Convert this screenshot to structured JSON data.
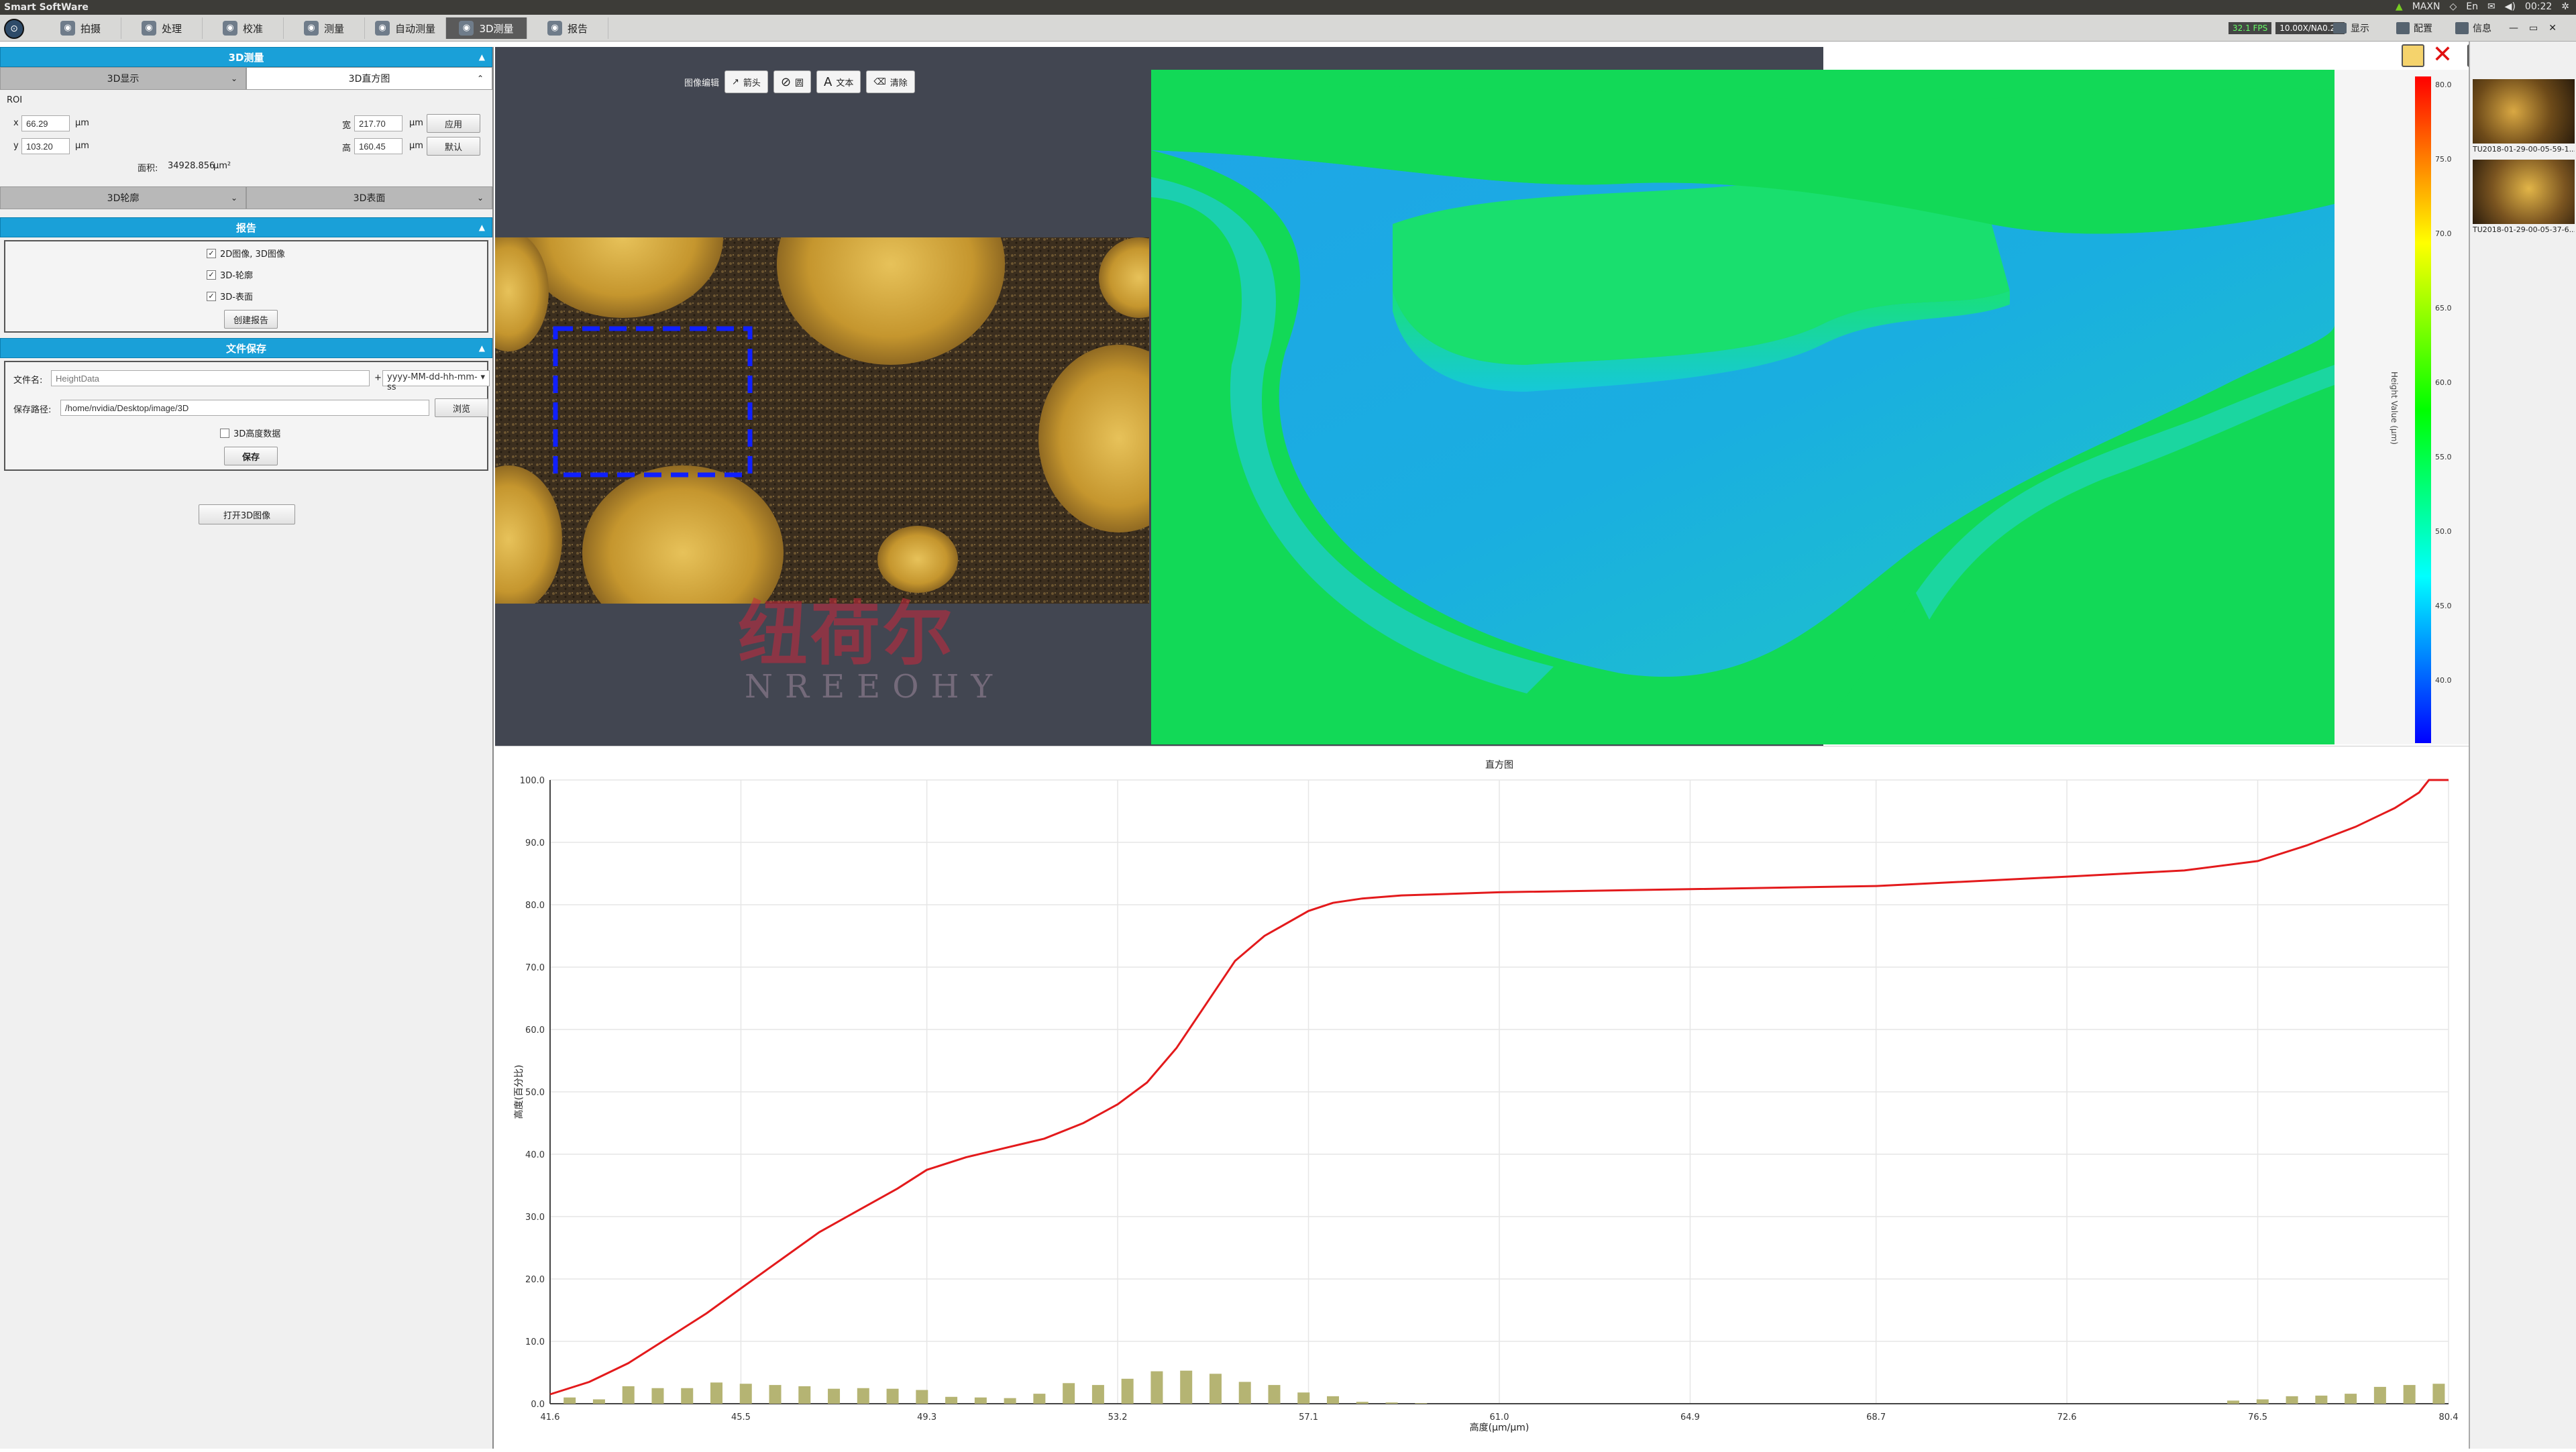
{
  "system_bar": {
    "title": "Smart SoftWare",
    "tray": [
      "MAXN",
      "00:22"
    ]
  },
  "toolbar": {
    "tabs": [
      {
        "label": "拍摄",
        "icon": "camera-icon"
      },
      {
        "label": "处理",
        "icon": "process-icon"
      },
      {
        "label": "校准",
        "icon": "calibrate-icon"
      },
      {
        "label": "测量",
        "icon": "measure-icon"
      },
      {
        "label": "自动测量",
        "icon": "auto-measure-icon"
      },
      {
        "label": "3D测量",
        "icon": "3d-measure-icon",
        "active": true
      },
      {
        "label": "报告",
        "icon": "report-icon"
      }
    ],
    "status_fps": "32.1 FPS",
    "status_exposure": "10.00X/NA0.25",
    "display_label": "显示",
    "config_label": "配置",
    "info_label": "信息"
  },
  "left_panel": {
    "section_3d": "3D测量",
    "subtabs_top": [
      "3D显示",
      "3D直方图"
    ],
    "roi_label": "ROI",
    "x_label": "x",
    "x_value": "66.29",
    "y_label": "y",
    "y_value": "103.20",
    "unit": "μm",
    "width_label": "宽",
    "width_value": "217.70",
    "height_label": "高",
    "height_value": "160.45",
    "apply_button": "应用",
    "default_button": "默认",
    "area_label": "面积:",
    "area_value": "34928.856",
    "area_unit": "μm²",
    "subtabs_bottom": [
      "3D轮廓",
      "3D表面"
    ],
    "section_report": "报告",
    "report_options": [
      "2D图像, 3D图像",
      "3D-轮廓",
      "3D-表面"
    ],
    "create_report_button": "创建报告",
    "section_save": "文件保存",
    "filename_label": "文件名:",
    "filename_placeholder": "HeightData",
    "plus": "+",
    "date_format": "yyyy-MM-dd-hh-mm-ss",
    "path_label": "保存路径:",
    "path_value": "/home/nvidia/Desktop/image/3D",
    "browse_button": "浏览",
    "save_height_label": "3D高度数据",
    "save_button": "保存",
    "open_3d_button": "打开3D图像"
  },
  "edit_bar": {
    "label": "图像编辑",
    "arrow": "箭头",
    "circle": "圆",
    "text": "文本",
    "clear": "清除"
  },
  "watermark": {
    "cn": "纽荷尔",
    "en": "NREEOHY"
  },
  "colorbar": {
    "ticks": [
      "80.0",
      "75.0",
      "70.0",
      "65.0",
      "60.0",
      "55.0",
      "50.0",
      "45.0",
      "40.0"
    ],
    "label": "Height Value (μm)",
    "colors": [
      "#ff0000",
      "#ffff00",
      "#00ff00",
      "#00ffff",
      "#0000ff"
    ]
  },
  "thumbnails": [
    {
      "name": "TU2018-01-29-00-05-59-1..."
    },
    {
      "name": "TU2018-01-29-00-05-37-6..."
    }
  ],
  "chart_data": {
    "type": "line",
    "title": "直方图",
    "xlabel": "高度(μm/μm)",
    "ylabel": "高度(百分比)",
    "xlim": [
      41.6,
      80.4
    ],
    "ylim": [
      0,
      100
    ],
    "x_ticks": [
      "41.6",
      "45.5",
      "49.3",
      "53.2",
      "57.1",
      "61.0",
      "64.9",
      "68.7",
      "72.6",
      "76.5",
      "80.4"
    ],
    "y_ticks": [
      "0.0",
      "10.0",
      "20.0",
      "30.0",
      "40.0",
      "50.0",
      "60.0",
      "70.0",
      "80.0",
      "90.0",
      "100.0"
    ],
    "series": [
      {
        "kind": "cumulative-line",
        "color": "#e31a1c",
        "x": [
          41.6,
          42.4,
          43.2,
          44.0,
          44.8,
          45.5,
          46.3,
          47.1,
          47.9,
          48.7,
          49.3,
          50.1,
          50.9,
          51.7,
          52.5,
          53.2,
          53.8,
          54.4,
          55.0,
          55.6,
          56.2,
          57.1,
          57.6,
          58.2,
          59.0,
          61.0,
          64.9,
          68.7,
          72.6,
          75.0,
          76.5,
          77.5,
          78.5,
          79.3,
          79.8,
          80.0,
          80.4
        ],
        "y": [
          1.5,
          3.5,
          6.5,
          10.5,
          14.5,
          18.5,
          23.0,
          27.5,
          31.0,
          34.5,
          37.5,
          39.5,
          41.0,
          42.5,
          45.0,
          48.0,
          51.5,
          57.0,
          64.0,
          71.0,
          75.0,
          79.0,
          80.3,
          81.0,
          81.5,
          82.0,
          82.5,
          83.0,
          84.5,
          85.5,
          87.0,
          89.5,
          92.5,
          95.5,
          98.0,
          100.0,
          100.0
        ]
      },
      {
        "kind": "bars",
        "color": "#b5b473",
        "x": [
          42.0,
          42.6,
          43.2,
          43.8,
          44.4,
          45.0,
          45.6,
          46.2,
          46.8,
          47.4,
          48.0,
          48.6,
          49.2,
          49.8,
          50.4,
          51.0,
          51.6,
          52.2,
          52.8,
          53.4,
          54.0,
          54.6,
          55.2,
          55.8,
          56.4,
          57.0,
          57.6,
          58.2,
          58.8,
          59.4,
          76.0,
          76.6,
          77.2,
          77.8,
          78.4,
          79.0,
          79.6,
          80.2
        ],
        "y": [
          1.0,
          0.7,
          2.8,
          2.5,
          2.5,
          3.4,
          3.2,
          3.0,
          2.8,
          2.4,
          2.5,
          2.4,
          2.2,
          1.1,
          1.0,
          0.9,
          1.6,
          3.3,
          3.0,
          4.0,
          5.2,
          5.3,
          4.8,
          3.5,
          3.0,
          1.8,
          1.2,
          0.3,
          0.2,
          0.1,
          0.5,
          0.7,
          1.2,
          1.3,
          1.6,
          2.7,
          3.0,
          3.2
        ]
      }
    ]
  }
}
